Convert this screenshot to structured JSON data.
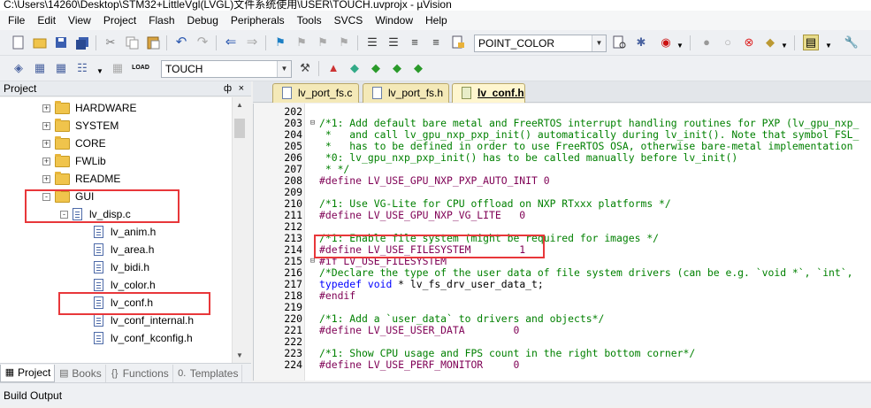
{
  "window": {
    "title": "C:\\Users\\14260\\Desktop\\STM32+LittleVgl(LVGL)文件系统使用\\USER\\TOUCH.uvprojx - µVision"
  },
  "menu": [
    "File",
    "Edit",
    "View",
    "Project",
    "Flash",
    "Debug",
    "Peripherals",
    "Tools",
    "SVCS",
    "Window",
    "Help"
  ],
  "toolbar": {
    "find_combo": "POINT_COLOR",
    "target_combo": "TOUCH"
  },
  "project_panel": {
    "title": "Project",
    "pin": "ф",
    "close": "×",
    "tree": [
      {
        "label": "HARDWARE",
        "kind": "folder",
        "expander": "+"
      },
      {
        "label": "SYSTEM",
        "kind": "folder",
        "expander": "+"
      },
      {
        "label": "CORE",
        "kind": "folder",
        "expander": "+"
      },
      {
        "label": "FWLib",
        "kind": "folder",
        "expander": "+"
      },
      {
        "label": "README",
        "kind": "folder",
        "expander": "+"
      },
      {
        "label": "GUI",
        "kind": "folder",
        "expander": "-"
      },
      {
        "label": "lv_disp.c",
        "kind": "file",
        "expander": "-"
      },
      {
        "label": "lv_anim.h",
        "kind": "file"
      },
      {
        "label": "lv_area.h",
        "kind": "file"
      },
      {
        "label": "lv_bidi.h",
        "kind": "file"
      },
      {
        "label": "lv_color.h",
        "kind": "file"
      },
      {
        "label": "lv_conf.h",
        "kind": "file"
      },
      {
        "label": "lv_conf_internal.h",
        "kind": "file"
      },
      {
        "label": "lv_conf_kconfig.h",
        "kind": "file"
      }
    ],
    "bottom_tabs": [
      {
        "label": "Project",
        "icon": "▦"
      },
      {
        "label": "Books",
        "icon": "▤"
      },
      {
        "label": "Functions",
        "icon": "{}"
      },
      {
        "label": "Templates",
        "icon": "0."
      }
    ]
  },
  "editor": {
    "tabs": [
      {
        "label": "lv_port_fs.c",
        "active": false
      },
      {
        "label": "lv_port_fs.h",
        "active": false
      },
      {
        "label": "lv_conf.h",
        "active": true
      }
    ],
    "lines": [
      {
        "n": "202",
        "f": "",
        "t": "",
        "c": "cmt"
      },
      {
        "n": "203",
        "f": "⊟",
        "t": "/*1: Add default bare metal and FreeRTOS interrupt handling routines for PXP (lv_gpu_nxp_",
        "c": "cmt"
      },
      {
        "n": "204",
        "f": "",
        "t": " *   and call lv_gpu_nxp_pxp_init() automatically during lv_init(). Note that symbol FSL_",
        "c": "cmt"
      },
      {
        "n": "205",
        "f": "",
        "t": " *   has to be defined in order to use FreeRTOS OSA, otherwise bare-metal implementation",
        "c": "cmt"
      },
      {
        "n": "206",
        "f": "",
        "t": " *0: lv_gpu_nxp_pxp_init() has to be called manually before lv_init()",
        "c": "cmt"
      },
      {
        "n": "207",
        "f": "",
        "t": " * */",
        "c": "cmt"
      },
      {
        "n": "208",
        "f": "",
        "t": "#define LV_USE_GPU_NXP_PXP_AUTO_INIT 0",
        "c": "pp"
      },
      {
        "n": "209",
        "f": "",
        "t": "",
        "c": ""
      },
      {
        "n": "210",
        "f": "",
        "t": "/*1: Use VG-Lite for CPU offload on NXP RTxxx platforms */",
        "c": "cmt"
      },
      {
        "n": "211",
        "f": "",
        "t": "#define LV_USE_GPU_NXP_VG_LITE   0",
        "c": "pp"
      },
      {
        "n": "212",
        "f": "",
        "t": "",
        "c": ""
      },
      {
        "n": "213",
        "f": "",
        "t": "/*1: Enable file system (might be required for images */",
        "c": "cmt"
      },
      {
        "n": "214",
        "f": "",
        "t": "#define LV_USE_FILESYSTEM        1",
        "c": "pp"
      },
      {
        "n": "215",
        "f": "⊟",
        "t": "#if LV_USE_FILESYSTEM",
        "c": "pp"
      },
      {
        "n": "216",
        "f": "",
        "t": "/*Declare the type of the user data of file system drivers (can be e.g. `void *`, `int`,",
        "c": "cmt"
      },
      {
        "n": "217",
        "f": "",
        "t": "typedef void * lv_fs_drv_user_data_t;",
        "c": "td"
      },
      {
        "n": "218",
        "f": "",
        "t": "#endif",
        "c": "pp"
      },
      {
        "n": "219",
        "f": "",
        "t": "",
        "c": ""
      },
      {
        "n": "220",
        "f": "",
        "t": "/*1: Add a `user_data` to drivers and objects*/",
        "c": "cmt"
      },
      {
        "n": "221",
        "f": "",
        "t": "#define LV_USE_USER_DATA        0",
        "c": "pp"
      },
      {
        "n": "222",
        "f": "",
        "t": "",
        "c": ""
      },
      {
        "n": "223",
        "f": "",
        "t": "/*1: Show CPU usage and FPS count in the right bottom corner*/",
        "c": "cmt"
      },
      {
        "n": "224",
        "f": "",
        "t": "#define LV_USE_PERF_MONITOR     0",
        "c": "pp"
      }
    ]
  },
  "status": {
    "build_output": "Build Output"
  },
  "colors": {
    "highlight_box": "#e8373a",
    "comment": "#008000",
    "preprocessor": "#7f0055",
    "keyword": "#0000ff"
  }
}
